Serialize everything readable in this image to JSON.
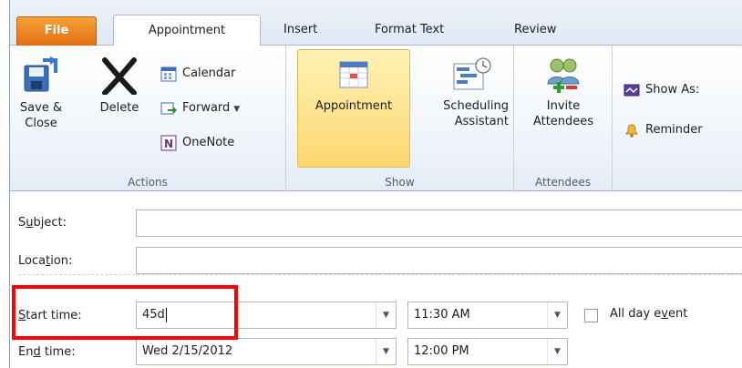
{
  "tabs": {
    "file": "File",
    "appointment": "Appointment",
    "insert": "Insert",
    "format_text": "Format Text",
    "review": "Review"
  },
  "ribbon": {
    "actions": {
      "label": "Actions",
      "save_close_line1": "Save &",
      "save_close_line2": "Close",
      "delete": "Delete",
      "calendar": "Calendar",
      "forward": "Forward",
      "onenote": "OneNote"
    },
    "show": {
      "label": "Show",
      "appointment": "Appointment",
      "scheduling_line1": "Scheduling",
      "scheduling_line2": "Assistant"
    },
    "attendees": {
      "label": "Attendees",
      "invite_line1": "Invite",
      "invite_line2": "Attendees"
    },
    "options": {
      "show_as": "Show As:",
      "reminder": "Reminder"
    }
  },
  "form": {
    "subject": {
      "label_pre": "S",
      "label_ul": "u",
      "label_post": "bject:",
      "value": ""
    },
    "location": {
      "label_pre": "Loca",
      "label_ul": "t",
      "label_post": "ion:",
      "value": ""
    },
    "start_time": {
      "label_pre": "",
      "label_ul": "S",
      "label_post": "tart time:",
      "date": "45d",
      "time": "11:30 AM"
    },
    "end_time": {
      "label_pre": "En",
      "label_ul": "d",
      "label_post": " time:",
      "date": "Wed 2/15/2012",
      "time": "12:00 PM"
    },
    "all_day": {
      "label_pre": "All day e",
      "label_ul": "v",
      "label_post": "ent",
      "checked": false
    }
  },
  "colors": {
    "file_tab": "#e26e11",
    "highlight": "#fcd770",
    "annotation": "#ff0000"
  }
}
